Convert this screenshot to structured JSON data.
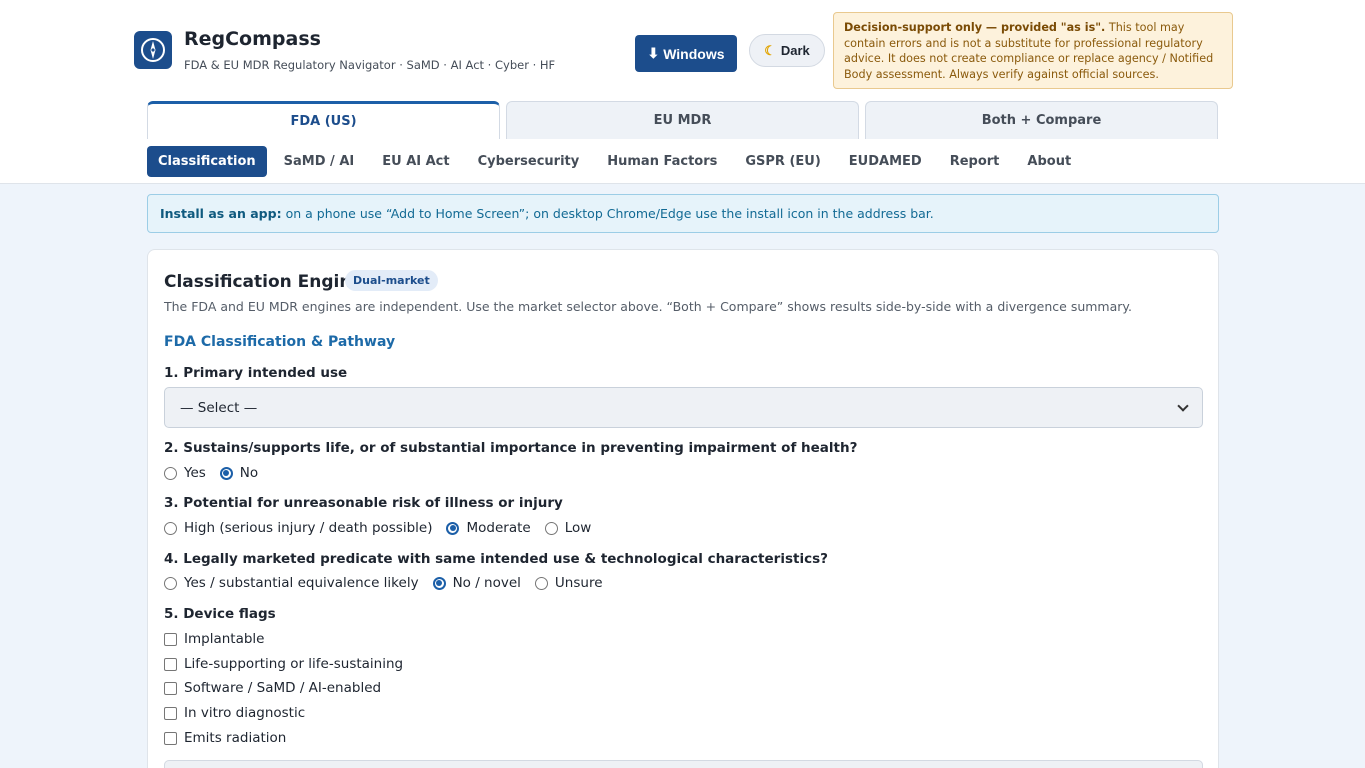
{
  "app": {
    "title": "RegCompass",
    "subtitle": "FDA & EU MDR Regulatory Navigator · SaMD · AI Act · Cyber · HF",
    "logo_icon": "compass-icon"
  },
  "header": {
    "windows_button": "Windows",
    "windows_icon": "download-icon",
    "dark_button": "Dark",
    "dark_icon": "moon-icon",
    "disclaimer_bold": "Decision-support only — provided \"as is\".",
    "disclaimer_text": " This tool may contain errors and is not a substitute for professional regulatory advice. It does not create compliance or replace agency / Notified Body assessment. Always verify against official sources."
  },
  "market_tabs": [
    {
      "label": "FDA (US)",
      "active": true
    },
    {
      "label": "EU MDR",
      "active": false
    },
    {
      "label": "Both + Compare",
      "active": false
    }
  ],
  "subnav": [
    {
      "label": "Classification",
      "active": true
    },
    {
      "label": "SaMD / AI"
    },
    {
      "label": "EU AI Act"
    },
    {
      "label": "Cybersecurity"
    },
    {
      "label": "Human Factors"
    },
    {
      "label": "GSPR (EU)"
    },
    {
      "label": "EUDAMED"
    },
    {
      "label": "Report"
    },
    {
      "label": "About"
    }
  ],
  "install": {
    "bold": "Install as an app:",
    "text": "on a phone use “Add to Home Screen”; on desktop Chrome/Edge use the install icon in the address bar."
  },
  "card": {
    "title": "Classification Engine",
    "badge": "Dual-market",
    "description": "The FDA and EU MDR engines are independent. Use the market selector above. “Both + Compare” shows results side-by-side with a divergence summary.",
    "section_title": "FDA Classification & Pathway",
    "q1": {
      "label": "1. Primary intended use",
      "value": "— Select —"
    },
    "q2": {
      "label": "2. Sustains/supports life, or of substantial importance in preventing impairment of health?",
      "options": [
        "Yes",
        "No"
      ],
      "selected": "No"
    },
    "q3": {
      "label": "3. Potential for unreasonable risk of illness or injury",
      "options": [
        "High (serious injury / death possible)",
        "Moderate",
        "Low"
      ],
      "selected": "Moderate"
    },
    "q4": {
      "label": "4. Legally marketed predicate with same intended use & technological characteristics?",
      "options": [
        "Yes / substantial equivalence likely",
        "No / novel",
        "Unsure"
      ],
      "selected": "No / novel"
    },
    "q5": {
      "label": "5. Device flags",
      "flags": [
        "Implantable",
        "Life-supporting or life-sustaining",
        "Software / SaMD / AI-enabled",
        "In vitro diagnostic",
        "Emits radiation"
      ],
      "checked": []
    }
  },
  "colors": {
    "primary": "#1c4d8c",
    "accent_link": "#1d6aa8",
    "warning_bg": "#fdf2dc",
    "info_bg": "#e6f3fa"
  }
}
